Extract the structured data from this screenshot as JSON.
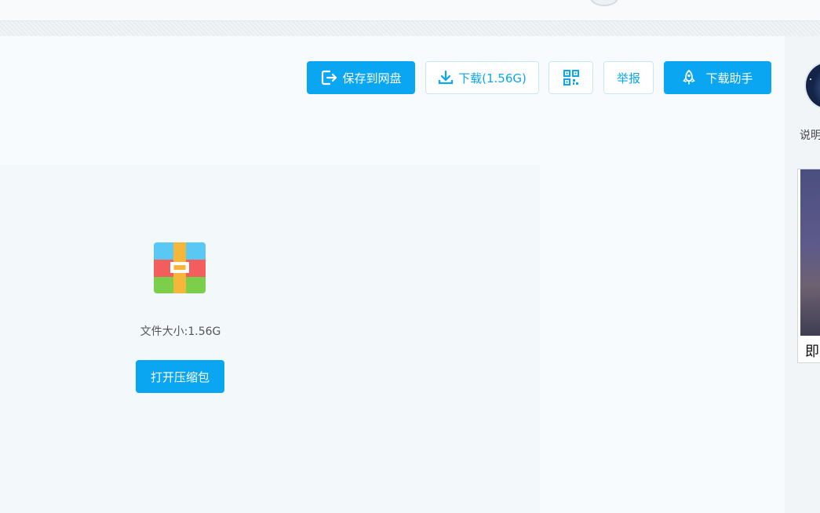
{
  "toolbar": {
    "save_to_disk": "保存到网盘",
    "download": "下载(1.56G)",
    "report": "举报",
    "download_helper": "下载助手"
  },
  "file": {
    "size_text": "文件大小:1.56G",
    "open_archive": "打开压缩包"
  },
  "sidebar": {
    "label": "说明",
    "ad_text": "即"
  },
  "colors": {
    "accent": "#0aa6f2",
    "outline": "#c9e6f8"
  },
  "icons": {
    "save": "export-icon",
    "download": "download-icon",
    "qr": "qrcode-icon",
    "helper": "rocket-icon",
    "archive": "zip-archive-icon"
  }
}
